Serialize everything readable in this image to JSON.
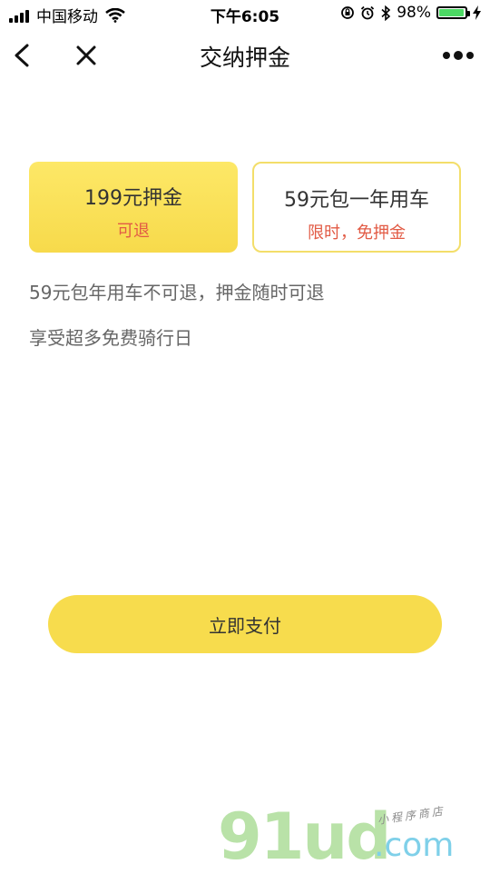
{
  "status_bar": {
    "carrier": "中国移动",
    "time": "下午6:05",
    "battery": "98%",
    "battery_level": 0.98
  },
  "nav": {
    "title": "交纳押金"
  },
  "options": [
    {
      "title": "199元押金",
      "subtitle": "可退"
    },
    {
      "title": "59元包一年用车",
      "subtitle": "限时，免押金"
    }
  ],
  "descriptions": [
    "59元包年用车不可退，押金随时可退",
    "享受超多免费骑行日"
  ],
  "pay_button": "立即支付",
  "watermark": {
    "logo": "91ud",
    "domain": ".com",
    "tagline": "小程序商店"
  },
  "colors": {
    "accent_yellow": "#f7dc4d",
    "highlight_red": "#e25b45",
    "battery_green": "#4cd964"
  }
}
